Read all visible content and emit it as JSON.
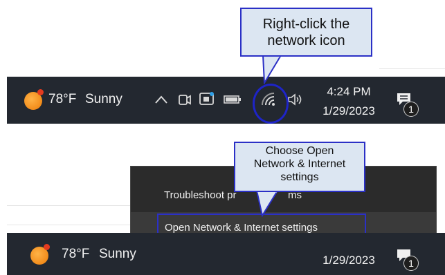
{
  "callout_top": {
    "line1": "Right-click the",
    "line2": "network icon"
  },
  "callout_bottom": {
    "line1": "Choose Open",
    "line2": "Network & Internet",
    "line3": "settings"
  },
  "taskbar_top": {
    "temperature": "78°F",
    "condition": "Sunny",
    "time": "4:24 PM",
    "date": "1/29/2023",
    "notification_count": "1"
  },
  "context_menu": {
    "items": [
      "Troubleshoot problems",
      "Open Network & Internet settings"
    ],
    "visible_item0": "Troubleshoot pr",
    "visible_item0_tail": "ms"
  },
  "taskbar_bottom": {
    "temperature": "78°F",
    "condition": "Sunny",
    "date": "1/29/2023",
    "notification_count": "1"
  },
  "colors": {
    "taskbar": "#232830",
    "callout_fill": "#dce6f2",
    "callout_border": "#2b30c6",
    "menu": "#2b2b2b",
    "highlight_ring": "#1e24c8"
  }
}
